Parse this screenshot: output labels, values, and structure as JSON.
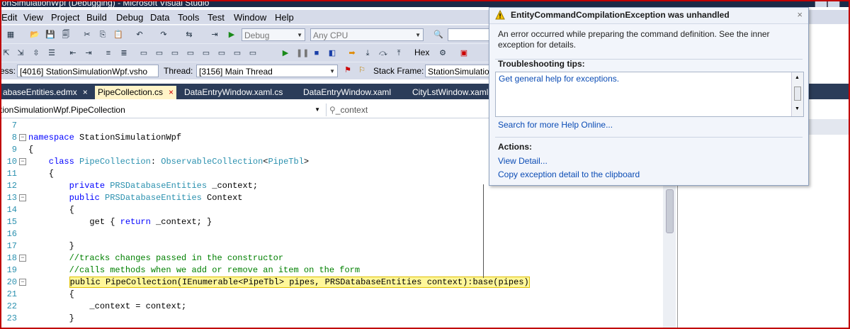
{
  "window": {
    "title": "ionSimulationWpf (Debugging) - Microsoft Visual Studio"
  },
  "menu": [
    "Edit",
    "View",
    "Project",
    "Build",
    "Debug",
    "Data",
    "Tools",
    "Test",
    "Window",
    "Help"
  ],
  "toolbar": {
    "config": "Debug",
    "platform": "Any CPU",
    "hex_label": "Hex"
  },
  "debug_location": {
    "process_label": "ess:",
    "process_value": "[4016] StationSimulationWpf.vsho",
    "thread_label": "Thread:",
    "thread_value": "[3156] Main Thread",
    "frame_label": "Stack Frame:",
    "frame_value": "StationSimulatio"
  },
  "tabs": [
    {
      "label": "abaseEntities.edmx",
      "close": "×"
    },
    {
      "label": "PipeCollection.cs",
      "close": "×"
    },
    {
      "label": "DataEntryWindow.xaml.cs"
    },
    {
      "label": "DataEntryWindow.xaml"
    },
    {
      "label": "CityLstWindow.xaml"
    }
  ],
  "navbar": {
    "type": "tionSimulationWpf.PipeCollection",
    "member": "_context"
  },
  "code": [
    {
      "n": "7",
      "fold": "",
      "text": ""
    },
    {
      "n": "8",
      "fold": "−",
      "text": ""
    },
    {
      "n": "9",
      "fold": "",
      "text": "{"
    },
    {
      "n": "10",
      "fold": "−",
      "text": ""
    },
    {
      "n": "11",
      "fold": "",
      "text": "    {"
    },
    {
      "n": "12",
      "fold": "",
      "text": ""
    },
    {
      "n": "13",
      "fold": "−",
      "text": ""
    },
    {
      "n": "14",
      "fold": "",
      "text": "        {"
    },
    {
      "n": "15",
      "fold": "",
      "text": ""
    },
    {
      "n": "16",
      "fold": "",
      "text": ""
    },
    {
      "n": "17",
      "fold": "",
      "text": "        }"
    },
    {
      "n": "18",
      "fold": "−",
      "text": ""
    },
    {
      "n": "19",
      "fold": "",
      "text": ""
    },
    {
      "n": "20",
      "fold": "−",
      "text": ""
    },
    {
      "n": "21",
      "fold": "",
      "text": "        {"
    },
    {
      "n": "22",
      "fold": "",
      "text": "            _context = context;"
    },
    {
      "n": "23",
      "fold": "",
      "text": "        }"
    }
  ],
  "code_tokens": {
    "l8_kw": "namespace",
    "l8_name": " StationSimulationWpf",
    "l10_kw": "    class",
    "l10_ty": " PipeCollection",
    "l10_sep": ": ",
    "l10_base": "ObservableCollection",
    "l10_lt": "<",
    "l10_arg": "PipeTbl",
    "l10_gt": ">",
    "l12_kw": "        private",
    "l12_ty": " PRSDatabaseEntities",
    "l12_rest": " _context;",
    "l13_kw": "        public",
    "l13_ty": " PRSDatabaseEntities",
    "l13_rest": " Context",
    "l15_pre": "            get { ",
    "l15_kw": "return",
    "l15_rest": " _context; }",
    "l18_cm": "        //tracks changes passed in the constructor",
    "l19_cm": "        //calls methods when we add or remove an item on the form",
    "l20_pre": "        ",
    "l20_hl": "public PipeCollection(IEnumerable<PipeTbl> pipes, PRSDatabaseEntities context):base(pipes)"
  },
  "exception": {
    "title": "EntityCommandCompilationException was unhandled",
    "close": "×",
    "message": "An error occurred while preparing the command definition. See the inner exception for details.",
    "tips_header": "Troubleshooting tips:",
    "tips": [
      "Get general help for exceptions."
    ],
    "search_link": "Search for more Help Online...",
    "actions_header": "Actions:",
    "actions": [
      "View Detail...",
      "Copy exception detail to the clipboard"
    ],
    "accent": "#0b4cb5"
  }
}
